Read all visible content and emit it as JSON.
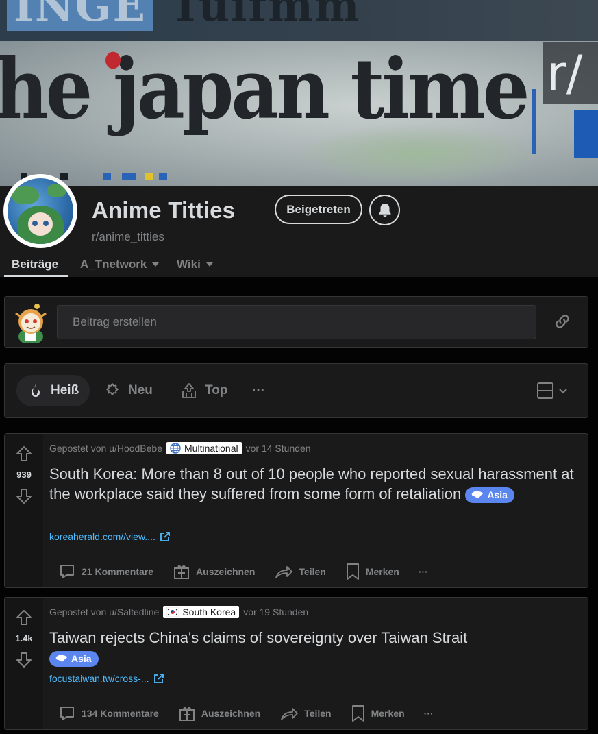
{
  "banner": {
    "top_text": "INGE",
    "top_text_rest": "Tuifmm",
    "main_text": "he japan time",
    "badge": "r/"
  },
  "community": {
    "name": "Anime Titties",
    "handle": "r/anime_titties",
    "join_label": "Beigetreten"
  },
  "tabs": [
    {
      "label": "Beiträge",
      "active": true
    },
    {
      "label": "A_Tnetwork",
      "dropdown": true
    },
    {
      "label": "Wiki",
      "dropdown": true
    }
  ],
  "create_post": {
    "placeholder": "Beitrag erstellen"
  },
  "sort": {
    "options": [
      {
        "label": "Heiß",
        "icon": "flame-icon",
        "active": true
      },
      {
        "label": "Neu",
        "icon": "sparkle-icon"
      },
      {
        "label": "Top",
        "icon": "top-icon"
      }
    ],
    "more": "···"
  },
  "posts": [
    {
      "score": "939",
      "posted_by": "Gepostet von u/HoodBebe",
      "flair": "Multinational",
      "flair_icon": "globe-icon",
      "time": "vor 14 Stunden",
      "title": "South Korea: More than 8 out of 10 people who reported sexual harassment at the workplace said they suffered from some form of retaliation",
      "tag": "Asia",
      "link": "koreaherald.com//view....",
      "comments": "21 Kommentare",
      "award": "Auszeichnen",
      "share": "Teilen",
      "save": "Merken",
      "more": "···"
    },
    {
      "score": "1.4k",
      "posted_by": "Gepostet von u/Saltedline",
      "flair": "South Korea",
      "flair_icon": "south-korea-flag-icon",
      "time": "vor 19 Stunden",
      "title": "Taiwan rejects China's claims of sovereignty over Taiwan Strait",
      "tag": "Asia",
      "link": "focustaiwan.tw/cross-...",
      "comments": "134 Kommentare",
      "award": "Auszeichnen",
      "share": "Teilen",
      "save": "Merken",
      "more": "···"
    }
  ],
  "colors": {
    "background": "#030303",
    "card": "#1a1a1b",
    "text": "#d7dadc",
    "muted": "#818384",
    "link": "#4fbcff",
    "asia_tag": "#5b86f0"
  }
}
